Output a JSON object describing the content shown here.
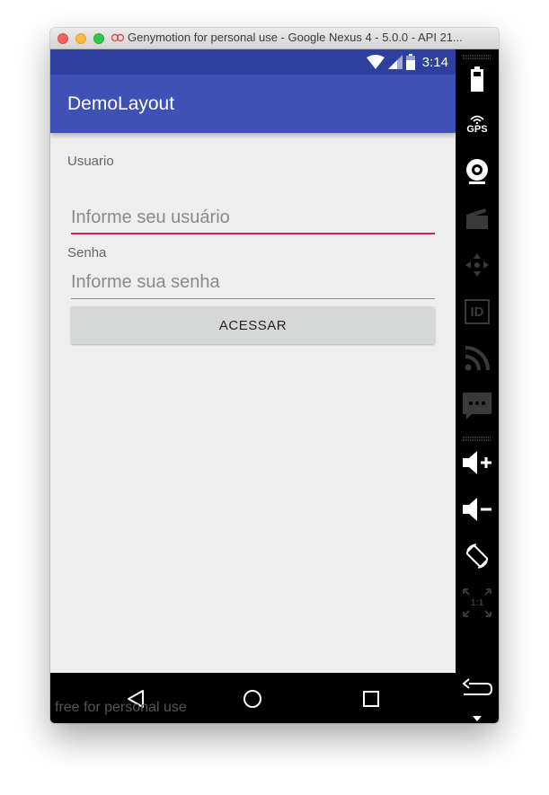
{
  "window": {
    "title": "Genymotion for personal use - Google Nexus 4 - 5.0.0 - API 21..."
  },
  "statusbar": {
    "time": "3:14"
  },
  "app": {
    "title": "DemoLayout"
  },
  "form": {
    "usuario_label": "Usuario",
    "usuario_placeholder": "Informe seu usuário",
    "usuario_value": "",
    "senha_label": "Senha",
    "senha_placeholder": "Informe sua senha",
    "senha_value": "",
    "submit_label": "ACESSAR"
  },
  "footer": {
    "watermark": "free for personal use"
  },
  "sidebar": {
    "gps_label": "GPS",
    "id_label": "ID",
    "scale_label": "1:1"
  },
  "colors": {
    "primary": "#3f51b5",
    "primary_dark": "#2f3f9e",
    "accent": "#d81b60",
    "background": "#eeeeee"
  }
}
